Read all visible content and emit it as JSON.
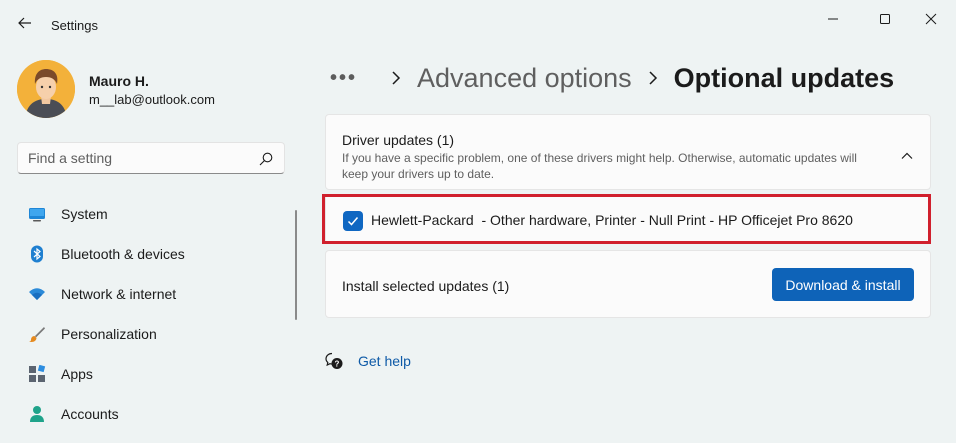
{
  "window": {
    "title": "Settings",
    "controls": {
      "minimize": "minimize-icon",
      "maximize": "maximize-icon",
      "close": "close-icon"
    }
  },
  "user": {
    "name": "Mauro H.",
    "email": "m__lab@outlook.com"
  },
  "search": {
    "placeholder": "Find a setting",
    "value": ""
  },
  "sidebar": {
    "items": [
      {
        "label": "System",
        "icon": "system-icon"
      },
      {
        "label": "Bluetooth & devices",
        "icon": "bluetooth-icon"
      },
      {
        "label": "Network & internet",
        "icon": "network-icon"
      },
      {
        "label": "Personalization",
        "icon": "brush-icon"
      },
      {
        "label": "Apps",
        "icon": "apps-icon"
      },
      {
        "label": "Accounts",
        "icon": "accounts-icon"
      }
    ]
  },
  "breadcrumb": {
    "more": "•••",
    "previous": "Advanced options",
    "current": "Optional updates"
  },
  "driver_updates": {
    "title": "Driver updates (1)",
    "description": "If you have a specific problem, one of these drivers might help. Otherwise, automatic updates will keep your drivers up to date.",
    "expanded": true,
    "items": [
      {
        "label": "Hewlett-Packard  - Other hardware, Printer - Null Print - HP Officejet Pro 8620",
        "checked": true
      }
    ]
  },
  "install": {
    "label": "Install selected updates (1)",
    "button": "Download & install"
  },
  "help": {
    "label": "Get help"
  },
  "colors": {
    "accent": "#0e63b8",
    "highlight_border": "#d0202d",
    "background": "#eef3f3",
    "card": "#fbfbfb"
  }
}
